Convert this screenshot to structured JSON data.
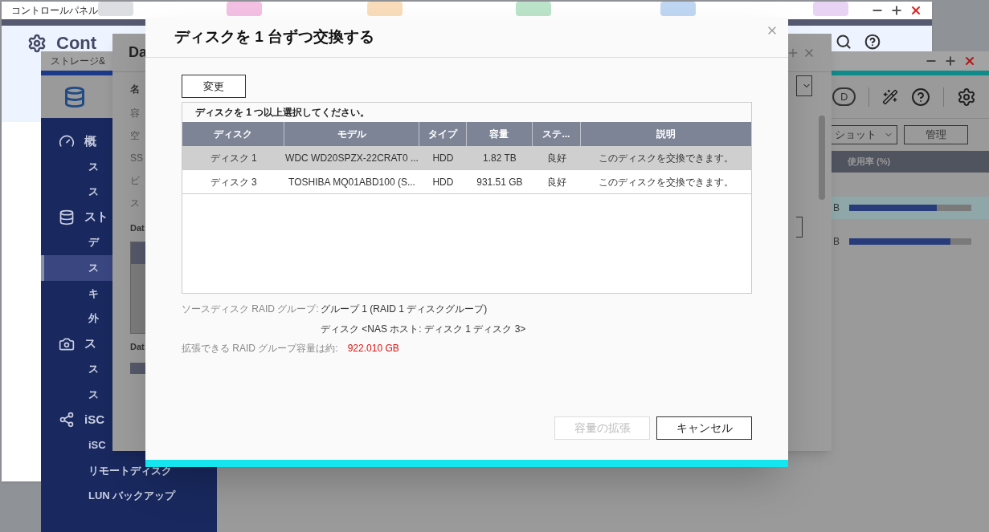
{
  "control_panel": {
    "title": "コントロールパネル",
    "heading": "Cont"
  },
  "storage_window": {
    "title": "ストレージ&",
    "sidebar": [
      {
        "label": "概",
        "kind": "gauge",
        "children": [
          {
            "label": "ス",
            "selected": false
          },
          {
            "label": "ス",
            "selected": false
          }
        ]
      },
      {
        "label": "スト",
        "kind": "database",
        "children": [
          {
            "label": "デ",
            "selected": false
          },
          {
            "label": "ス",
            "selected": true
          },
          {
            "label": "キ",
            "selected": false
          },
          {
            "label": "外",
            "selected": false
          }
        ]
      },
      {
        "label": "ス",
        "kind": "snapshot",
        "children": [
          {
            "label": "ス",
            "selected": false
          },
          {
            "label": "ス",
            "selected": false
          }
        ]
      },
      {
        "label": "iSC",
        "kind": "iscsi",
        "children": [
          {
            "label": "iSC",
            "selected": false
          },
          {
            "label": "リモートディスク",
            "selected": false
          },
          {
            "label": "LUN バックアップ",
            "selected": false
          }
        ]
      }
    ]
  },
  "volume_window": {
    "title": "Da",
    "fields": [
      "名",
      "容",
      "空",
      "SS",
      "ビ",
      "ス"
    ],
    "sections": [
      "Dat",
      "Dat"
    ]
  },
  "right_panel": {
    "pill": "D",
    "dropdown": "ショット",
    "manage_button": "管理",
    "column": "使用率 (%)",
    "rows": [
      {
        "size": "B",
        "level": 0.72,
        "selected": true
      },
      {
        "size": "B",
        "level": 0.83,
        "selected": false
      }
    ]
  },
  "dialog": {
    "title": "ディスクを 1 台ずつ交換する",
    "change_button": "変更",
    "hint": "ディスクを 1 つ以上選択してください。",
    "columns": [
      "ディスク",
      "モデル",
      "タイプ",
      "容量",
      "ステ...",
      "説明"
    ],
    "rows": [
      {
        "cells": [
          "ディスク 1",
          "WDC WD20SPZX-22CRAT0 ...",
          "HDD",
          "1.82 TB",
          "良好",
          "このディスクを交換できます。"
        ],
        "selected": true
      },
      {
        "cells": [
          "ディスク 3",
          "TOSHIBA MQ01ABD100 (S...",
          "HDD",
          "931.51 GB",
          "良好",
          "このディスクを交換できます。"
        ],
        "selected": false
      }
    ],
    "info": [
      {
        "label": "ソースディスク RAID グループ:",
        "value": "グループ 1 (RAID 1 ディスクグループ)"
      },
      {
        "value": "ディスク <NAS ホスト: ディスク 1 ディスク 3>"
      }
    ],
    "capacity": {
      "label": "拡張できる RAID グループ容量は約:",
      "value": "922.010 GB"
    },
    "buttons": [
      {
        "label": "容量の拡張",
        "disabled": true
      },
      {
        "label": "キャンセル",
        "disabled": false
      }
    ]
  }
}
